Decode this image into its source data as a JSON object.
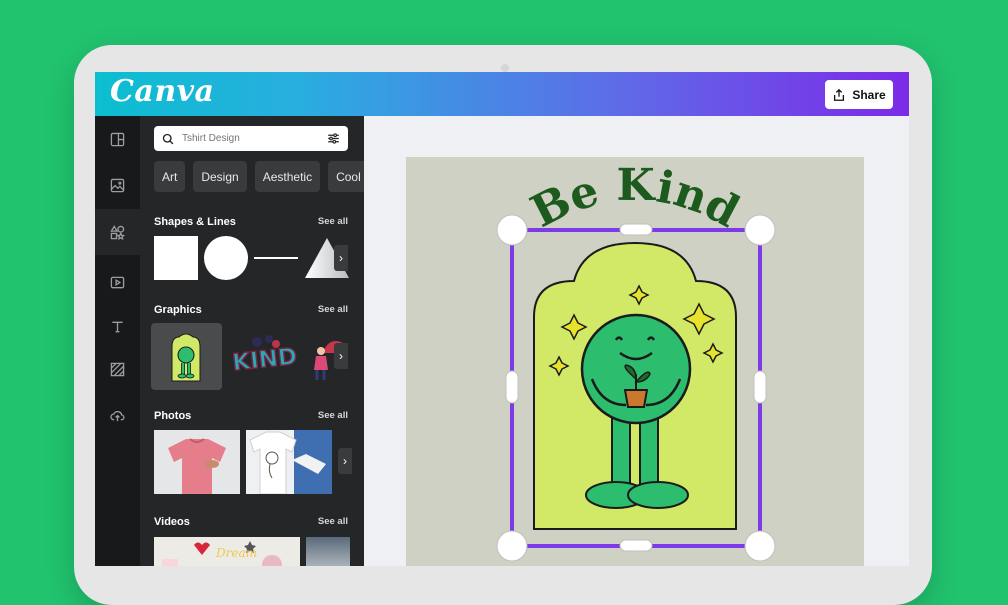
{
  "app": {
    "logo_text": "Canva"
  },
  "header": {
    "share_label": "Share"
  },
  "sidebar": {
    "rail": [
      {
        "icon": "templates-icon"
      },
      {
        "icon": "image-icon"
      },
      {
        "icon": "elements-icon",
        "active": true
      },
      {
        "icon": "video-icon"
      },
      {
        "icon": "text-icon"
      },
      {
        "icon": "background-icon"
      },
      {
        "icon": "upload-icon"
      }
    ]
  },
  "panel": {
    "search": {
      "value": "",
      "placeholder": "Tshirt Design"
    },
    "chips": [
      "Art",
      "Design",
      "Aesthetic",
      "Cool"
    ],
    "sections": [
      {
        "title": "Shapes & Lines",
        "see_all": "See all"
      },
      {
        "title": "Graphics",
        "see_all": "See all"
      },
      {
        "title": "Photos",
        "see_all": "See all"
      },
      {
        "title": "Videos",
        "see_all": "See all"
      }
    ],
    "graphics": [
      {
        "name": "be-kind-character-graphic"
      },
      {
        "name": "kind-lettering-graphic"
      },
      {
        "name": "umbrella-person-graphic"
      }
    ]
  },
  "canvas": {
    "design_text": "Be Kind",
    "colors": {
      "text": "#1d5a1e",
      "arch": "#d2e867",
      "character": "#2dbd6e",
      "selection": "#7d3be8",
      "page": "#cfd1c4"
    }
  }
}
